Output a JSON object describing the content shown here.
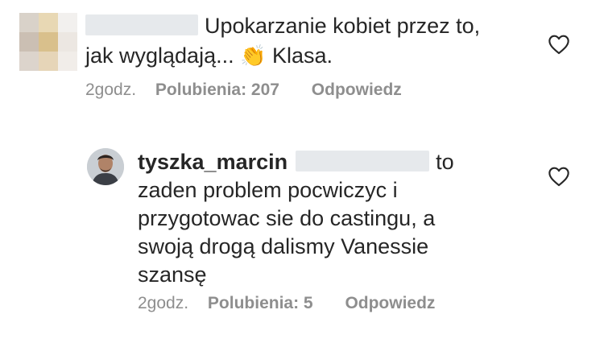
{
  "comments": [
    {
      "text_line1": "Upokarzanie kobiet przez to,",
      "text_line2_start": "jak wyglądają...",
      "emoji": "👏",
      "text_line2_end": "Klasa.",
      "time": "2godz.",
      "likes": "Polubienia: 207",
      "reply": "Odpowiedz",
      "icon": "heart-outline-icon"
    },
    {
      "username": "tyszka_marcin",
      "text_line1_end": "to",
      "text_line2": "zaden problem pocwiczyc i",
      "text_line3": "przygotowac sie do castingu, a",
      "text_line4": "swoją drogą dalismy Vanessie",
      "text_line5": "szansę",
      "time": "2godz.",
      "likes": "Polubienia: 5",
      "reply": "Odpowiedz",
      "icon": "heart-outline-icon"
    }
  ],
  "colors": {
    "text": "#262626",
    "meta": "#8e8e8e",
    "redaction": "#e6e9ec"
  }
}
